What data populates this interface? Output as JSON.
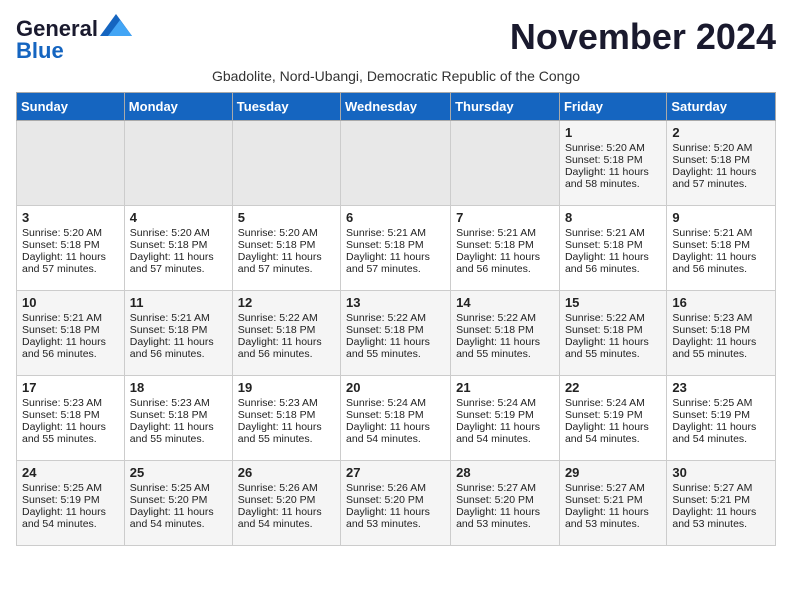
{
  "logo": {
    "line1": "General",
    "line2": "Blue"
  },
  "title": "November 2024",
  "subtitle": "Gbadolite, Nord-Ubangi, Democratic Republic of the Congo",
  "days_of_week": [
    "Sunday",
    "Monday",
    "Tuesday",
    "Wednesday",
    "Thursday",
    "Friday",
    "Saturday"
  ],
  "weeks": [
    [
      {
        "day": "",
        "content": ""
      },
      {
        "day": "",
        "content": ""
      },
      {
        "day": "",
        "content": ""
      },
      {
        "day": "",
        "content": ""
      },
      {
        "day": "",
        "content": ""
      },
      {
        "day": "1",
        "content": "Sunrise: 5:20 AM\nSunset: 5:18 PM\nDaylight: 11 hours\nand 58 minutes."
      },
      {
        "day": "2",
        "content": "Sunrise: 5:20 AM\nSunset: 5:18 PM\nDaylight: 11 hours\nand 57 minutes."
      }
    ],
    [
      {
        "day": "3",
        "content": "Sunrise: 5:20 AM\nSunset: 5:18 PM\nDaylight: 11 hours\nand 57 minutes."
      },
      {
        "day": "4",
        "content": "Sunrise: 5:20 AM\nSunset: 5:18 PM\nDaylight: 11 hours\nand 57 minutes."
      },
      {
        "day": "5",
        "content": "Sunrise: 5:20 AM\nSunset: 5:18 PM\nDaylight: 11 hours\nand 57 minutes."
      },
      {
        "day": "6",
        "content": "Sunrise: 5:21 AM\nSunset: 5:18 PM\nDaylight: 11 hours\nand 57 minutes."
      },
      {
        "day": "7",
        "content": "Sunrise: 5:21 AM\nSunset: 5:18 PM\nDaylight: 11 hours\nand 56 minutes."
      },
      {
        "day": "8",
        "content": "Sunrise: 5:21 AM\nSunset: 5:18 PM\nDaylight: 11 hours\nand 56 minutes."
      },
      {
        "day": "9",
        "content": "Sunrise: 5:21 AM\nSunset: 5:18 PM\nDaylight: 11 hours\nand 56 minutes."
      }
    ],
    [
      {
        "day": "10",
        "content": "Sunrise: 5:21 AM\nSunset: 5:18 PM\nDaylight: 11 hours\nand 56 minutes."
      },
      {
        "day": "11",
        "content": "Sunrise: 5:21 AM\nSunset: 5:18 PM\nDaylight: 11 hours\nand 56 minutes."
      },
      {
        "day": "12",
        "content": "Sunrise: 5:22 AM\nSunset: 5:18 PM\nDaylight: 11 hours\nand 56 minutes."
      },
      {
        "day": "13",
        "content": "Sunrise: 5:22 AM\nSunset: 5:18 PM\nDaylight: 11 hours\nand 55 minutes."
      },
      {
        "day": "14",
        "content": "Sunrise: 5:22 AM\nSunset: 5:18 PM\nDaylight: 11 hours\nand 55 minutes."
      },
      {
        "day": "15",
        "content": "Sunrise: 5:22 AM\nSunset: 5:18 PM\nDaylight: 11 hours\nand 55 minutes."
      },
      {
        "day": "16",
        "content": "Sunrise: 5:23 AM\nSunset: 5:18 PM\nDaylight: 11 hours\nand 55 minutes."
      }
    ],
    [
      {
        "day": "17",
        "content": "Sunrise: 5:23 AM\nSunset: 5:18 PM\nDaylight: 11 hours\nand 55 minutes."
      },
      {
        "day": "18",
        "content": "Sunrise: 5:23 AM\nSunset: 5:18 PM\nDaylight: 11 hours\nand 55 minutes."
      },
      {
        "day": "19",
        "content": "Sunrise: 5:23 AM\nSunset: 5:18 PM\nDaylight: 11 hours\nand 55 minutes."
      },
      {
        "day": "20",
        "content": "Sunrise: 5:24 AM\nSunset: 5:18 PM\nDaylight: 11 hours\nand 54 minutes."
      },
      {
        "day": "21",
        "content": "Sunrise: 5:24 AM\nSunset: 5:19 PM\nDaylight: 11 hours\nand 54 minutes."
      },
      {
        "day": "22",
        "content": "Sunrise: 5:24 AM\nSunset: 5:19 PM\nDaylight: 11 hours\nand 54 minutes."
      },
      {
        "day": "23",
        "content": "Sunrise: 5:25 AM\nSunset: 5:19 PM\nDaylight: 11 hours\nand 54 minutes."
      }
    ],
    [
      {
        "day": "24",
        "content": "Sunrise: 5:25 AM\nSunset: 5:19 PM\nDaylight: 11 hours\nand 54 minutes."
      },
      {
        "day": "25",
        "content": "Sunrise: 5:25 AM\nSunset: 5:20 PM\nDaylight: 11 hours\nand 54 minutes."
      },
      {
        "day": "26",
        "content": "Sunrise: 5:26 AM\nSunset: 5:20 PM\nDaylight: 11 hours\nand 54 minutes."
      },
      {
        "day": "27",
        "content": "Sunrise: 5:26 AM\nSunset: 5:20 PM\nDaylight: 11 hours\nand 53 minutes."
      },
      {
        "day": "28",
        "content": "Sunrise: 5:27 AM\nSunset: 5:20 PM\nDaylight: 11 hours\nand 53 minutes."
      },
      {
        "day": "29",
        "content": "Sunrise: 5:27 AM\nSunset: 5:21 PM\nDaylight: 11 hours\nand 53 minutes."
      },
      {
        "day": "30",
        "content": "Sunrise: 5:27 AM\nSunset: 5:21 PM\nDaylight: 11 hours\nand 53 minutes."
      }
    ]
  ]
}
